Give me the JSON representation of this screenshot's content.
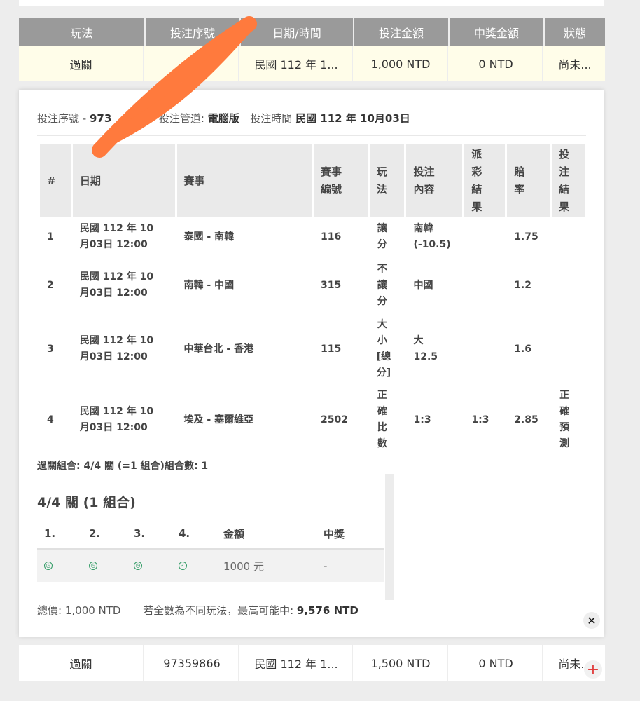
{
  "headers": [
    "玩法",
    "投注序號",
    "日期/時間",
    "投注金額",
    "中獎金額",
    "狀態"
  ],
  "bet_rows": [
    {
      "type": "過關",
      "serial": "9          0",
      "datetime": "民國 112 年 1...",
      "amount": "1,000 NTD",
      "prize": "0 NTD",
      "status": "尚未..."
    },
    {
      "type": "過關",
      "serial": "97359866",
      "datetime": "民國 112 年 1...",
      "amount": "1,500 NTD",
      "prize": "0 NTD",
      "status": "尚未..."
    }
  ],
  "detail": {
    "serial_label": "投注序號 -",
    "serial_value": "973",
    "channel_label": "投注管道:",
    "channel_value": "電腦版",
    "time_label": "投注時間",
    "time_value": "民國 112 年 10月03日",
    "leg_headers": [
      "#",
      "日期",
      "賽事",
      "賽事編號",
      "玩法",
      "投注內容",
      "派彩結果",
      "賠率",
      "投注結果"
    ],
    "legs": [
      {
        "no": "1",
        "date": "民國 112 年 10月03日 12:00",
        "match": "泰國 - 南韓",
        "code": "116",
        "play": "讓分",
        "pick": "南韓 (-10.5)",
        "settle": "",
        "odds": "1.75",
        "result": ""
      },
      {
        "no": "2",
        "date": "民國 112 年 10月03日 12:00",
        "match": "南韓 - 中國",
        "code": "315",
        "play": "不讓分",
        "pick": "中國",
        "settle": "",
        "odds": "1.2",
        "result": ""
      },
      {
        "no": "3",
        "date": "民國 112 年 10月03日 12:00",
        "match": "中華台北 - 香港",
        "code": "115",
        "play": "大小[總分]",
        "pick": "大 12.5",
        "settle": "",
        "odds": "1.6",
        "result": ""
      },
      {
        "no": "4",
        "date": "民國 112 年 10月03日 12:00",
        "match": "埃及 - 塞爾維亞",
        "code": "2502",
        "play": "正確比數",
        "pick": "1:3",
        "settle": "1:3",
        "odds": "2.85",
        "result": "正確預測"
      }
    ],
    "combo_summary": "過關組合: 4/4 關 (=1 組合)組合數: 1",
    "combo_title": "4/4 關 (1 組合)",
    "combo_headers": [
      "1.",
      "2.",
      "3.",
      "4.",
      "金額",
      "中獎"
    ],
    "combo_row": {
      "icons": [
        "pending-icon",
        "pending-icon",
        "pending-icon",
        "check-icon"
      ],
      "amount": "1000 元",
      "prize": "-"
    },
    "total_label": "總價:",
    "total_value": "1,000 NTD",
    "max_label": "若全數為不同玩法，最高可能中:",
    "max_value": "9,576 NTD"
  },
  "colors": {
    "header_bg": "#9a9a9a",
    "highlight_row": "#fffde9",
    "stroke": "#ff7a3d",
    "icon_green": "#2e9a63"
  }
}
